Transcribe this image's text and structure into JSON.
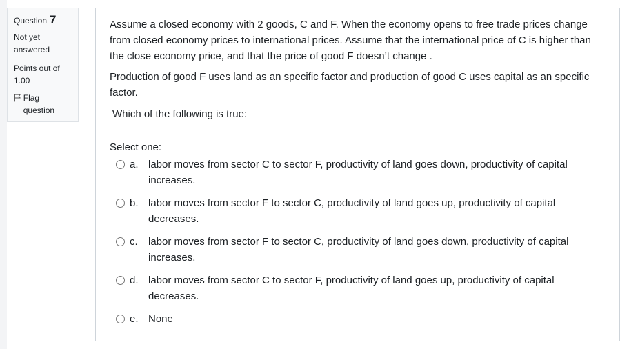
{
  "question_info": {
    "label": "Question",
    "number": "7",
    "state": "Not yet answered",
    "grade": "Points out of 1.00",
    "flag_label": "Flag question"
  },
  "question": {
    "paragraphs": [
      "Assume a closed economy with 2 goods, C and F. When the economy opens to free trade prices change from closed economy prices to international prices. Assume that the international price of C is higher than the close economy price, and that the price of good F doesn’t change .",
      "Production of good F uses land as an specific factor and production of good C uses capital as an specific factor.",
      "Which of the following is true:"
    ],
    "prompt": "Select one:",
    "options": [
      {
        "letter": "a.",
        "text": "labor moves from sector C to sector F, productivity of land goes down, productivity of capital increases."
      },
      {
        "letter": "b.",
        "text": "labor moves from sector F to sector C, productivity of land goes up, productivity of capital decreases."
      },
      {
        "letter": "c.",
        "text": "labor moves from sector F to sector C, productivity of land goes down, productivity of capital increases."
      },
      {
        "letter": "d.",
        "text": "labor moves from sector C to sector F, productivity of land goes up, productivity of capital decreases."
      },
      {
        "letter": "e.",
        "text": "None"
      }
    ]
  },
  "icons": {
    "flag": "flag-outline-icon",
    "radio": "radio-unchecked"
  }
}
